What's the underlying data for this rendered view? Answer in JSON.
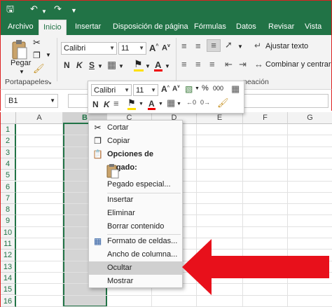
{
  "tabs": [
    "Archivo",
    "Inicio",
    "Insertar",
    "Disposición de página",
    "Fórmulas",
    "Datos",
    "Revisar",
    "Vista"
  ],
  "ribbon": {
    "paste_label": "Pegar",
    "font_name": "Calibri",
    "font_size": "11",
    "wrap_text": "Ajustar texto",
    "merge_center": "Combinar y centrar",
    "clipboard_group": "Portapapeles",
    "alignment_group_partial": "neación"
  },
  "name_box": "B1",
  "columns": [
    "A",
    "B",
    "C",
    "D",
    "E",
    "F",
    "G"
  ],
  "rows": [
    "1",
    "2",
    "3",
    "4",
    "5",
    "6",
    "7",
    "8",
    "9",
    "10",
    "11",
    "12",
    "13",
    "14",
    "15",
    "16"
  ],
  "mini_toolbar": {
    "font_name": "Calibri",
    "font_size": "11",
    "percent": "%",
    "thousands": "000"
  },
  "context_menu": {
    "cut": "Cortar",
    "copy": "Copiar",
    "paste_options": "Opciones de pegado:",
    "paste_special": "Pegado especial...",
    "insert": "Insertar",
    "delete": "Eliminar",
    "clear": "Borrar contenido",
    "format_cells": "Formato de celdas...",
    "column_width": "Ancho de columna...",
    "hide": "Ocultar",
    "unhide": "Mostrar"
  },
  "colors": {
    "excel_green": "#217346",
    "selection": "#d4d4d4",
    "arrow_red": "#e8101b"
  }
}
